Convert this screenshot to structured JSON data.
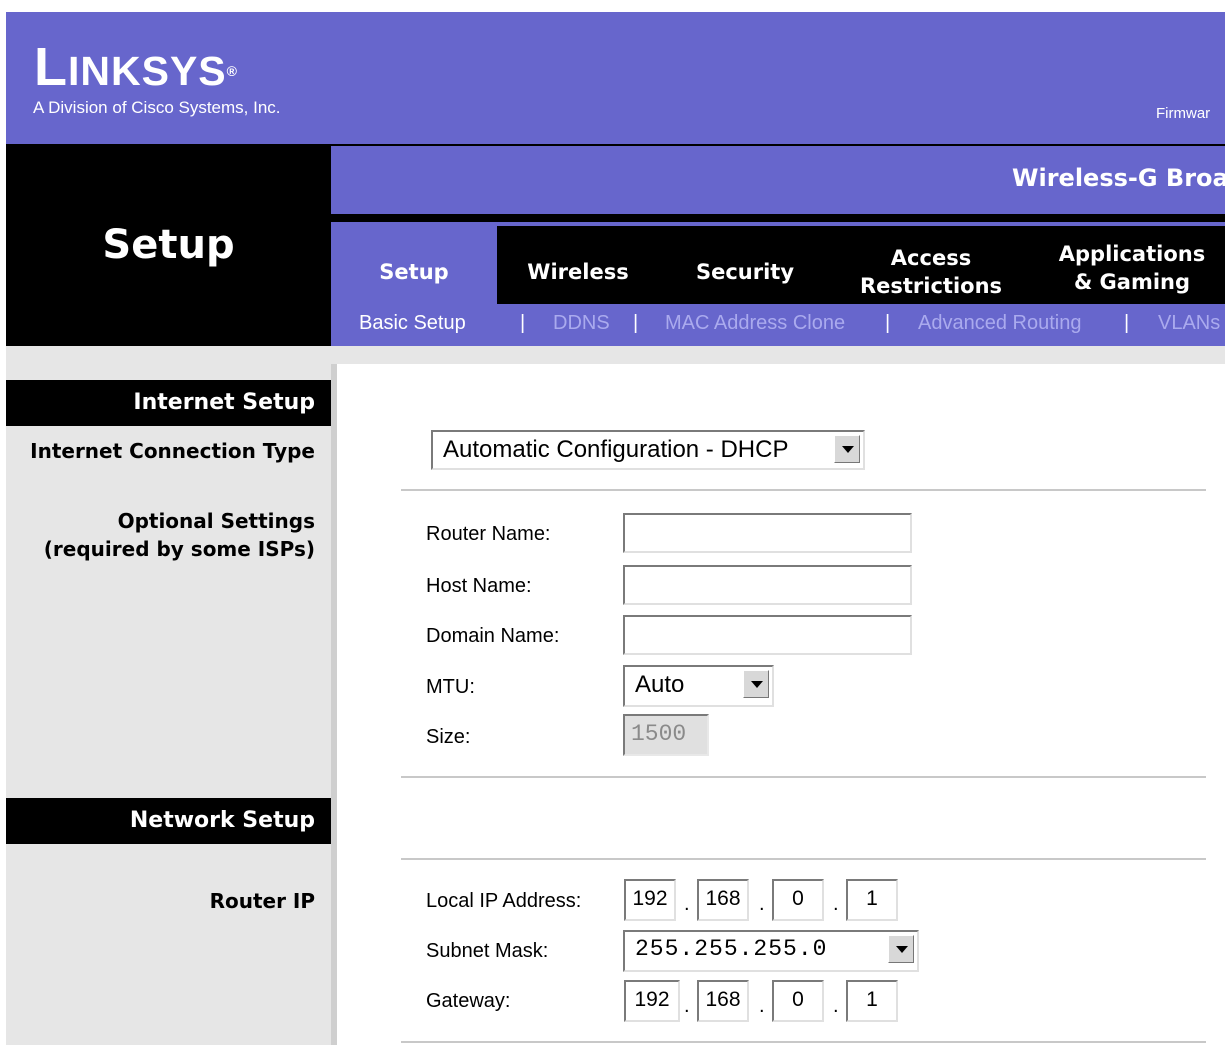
{
  "header": {
    "logo_main": "LINKSYS",
    "logo_registered": "®",
    "tagline": "A Division of Cisco Systems, Inc.",
    "firmware_label": "Firmwar"
  },
  "page_title": "Setup",
  "product_title": "Wireless-G Broa",
  "tabs": [
    {
      "label": "Setup",
      "active": true
    },
    {
      "label": "Wireless",
      "active": false
    },
    {
      "label": "Security",
      "active": false
    },
    {
      "label": "Access Restrictions",
      "active": false
    },
    {
      "label": "Applications & Gaming",
      "active": false
    }
  ],
  "subtabs": [
    {
      "label": "Basic Setup",
      "active": true
    },
    {
      "label": "DDNS",
      "active": false
    },
    {
      "label": "MAC Address Clone",
      "active": false
    },
    {
      "label": "Advanced Routing",
      "active": false
    },
    {
      "label": "VLANs",
      "active": false
    }
  ],
  "subtab_separator": "|",
  "sections": {
    "internet_setup": "Internet Setup",
    "network_setup": "Network Setup"
  },
  "left_labels": {
    "connection_type": "Internet Connection Type",
    "optional_settings": "Optional Settings",
    "optional_required": "(required by some ISPs)",
    "router_ip": "Router IP"
  },
  "form": {
    "connection_type_value": "Automatic Configuration - DHCP",
    "router_name_label": "Router Name:",
    "router_name_value": "",
    "host_name_label": "Host Name:",
    "host_name_value": "",
    "domain_name_label": "Domain Name:",
    "domain_name_value": "",
    "mtu_label": "MTU:",
    "mtu_value": "Auto",
    "size_label": "Size:",
    "size_value": "1500"
  },
  "network": {
    "local_ip_label": "Local IP Address:",
    "local_ip": [
      "192",
      "168",
      "0",
      "1"
    ],
    "subnet_label": "Subnet Mask:",
    "subnet_value": "255.255.255.0",
    "gateway_label": "Gateway:",
    "gateway": [
      "192",
      "168",
      "0",
      "1"
    ]
  },
  "ip_separator": ".",
  "colors": {
    "brand_purple": "#6766cc",
    "black": "#000000",
    "panel_gray": "#e6e6e6"
  }
}
